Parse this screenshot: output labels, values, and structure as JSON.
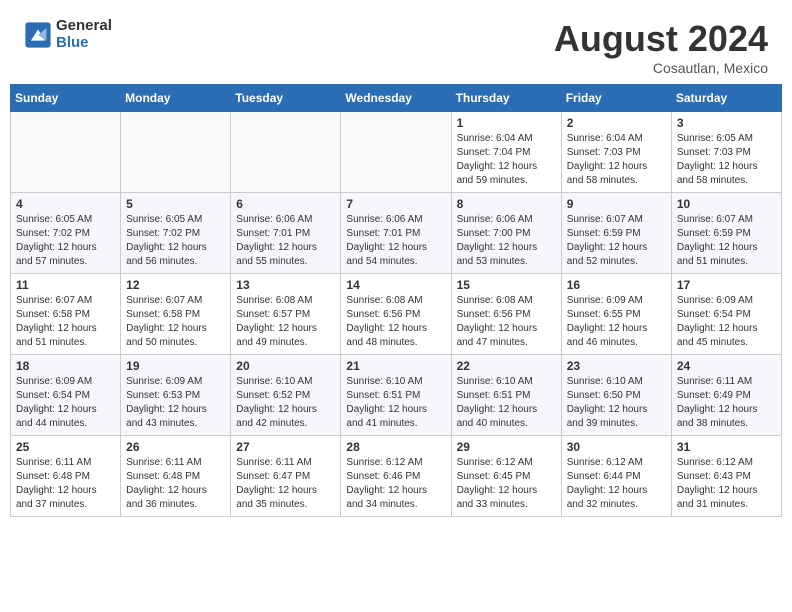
{
  "header": {
    "logo_general": "General",
    "logo_blue": "Blue",
    "title": "August 2024",
    "location": "Cosautlan, Mexico"
  },
  "days_of_week": [
    "Sunday",
    "Monday",
    "Tuesday",
    "Wednesday",
    "Thursday",
    "Friday",
    "Saturday"
  ],
  "weeks": [
    [
      {
        "day": "",
        "info": ""
      },
      {
        "day": "",
        "info": ""
      },
      {
        "day": "",
        "info": ""
      },
      {
        "day": "",
        "info": ""
      },
      {
        "day": "1",
        "info": "Sunrise: 6:04 AM\nSunset: 7:04 PM\nDaylight: 12 hours\nand 59 minutes."
      },
      {
        "day": "2",
        "info": "Sunrise: 6:04 AM\nSunset: 7:03 PM\nDaylight: 12 hours\nand 58 minutes."
      },
      {
        "day": "3",
        "info": "Sunrise: 6:05 AM\nSunset: 7:03 PM\nDaylight: 12 hours\nand 58 minutes."
      }
    ],
    [
      {
        "day": "4",
        "info": "Sunrise: 6:05 AM\nSunset: 7:02 PM\nDaylight: 12 hours\nand 57 minutes."
      },
      {
        "day": "5",
        "info": "Sunrise: 6:05 AM\nSunset: 7:02 PM\nDaylight: 12 hours\nand 56 minutes."
      },
      {
        "day": "6",
        "info": "Sunrise: 6:06 AM\nSunset: 7:01 PM\nDaylight: 12 hours\nand 55 minutes."
      },
      {
        "day": "7",
        "info": "Sunrise: 6:06 AM\nSunset: 7:01 PM\nDaylight: 12 hours\nand 54 minutes."
      },
      {
        "day": "8",
        "info": "Sunrise: 6:06 AM\nSunset: 7:00 PM\nDaylight: 12 hours\nand 53 minutes."
      },
      {
        "day": "9",
        "info": "Sunrise: 6:07 AM\nSunset: 6:59 PM\nDaylight: 12 hours\nand 52 minutes."
      },
      {
        "day": "10",
        "info": "Sunrise: 6:07 AM\nSunset: 6:59 PM\nDaylight: 12 hours\nand 51 minutes."
      }
    ],
    [
      {
        "day": "11",
        "info": "Sunrise: 6:07 AM\nSunset: 6:58 PM\nDaylight: 12 hours\nand 51 minutes."
      },
      {
        "day": "12",
        "info": "Sunrise: 6:07 AM\nSunset: 6:58 PM\nDaylight: 12 hours\nand 50 minutes."
      },
      {
        "day": "13",
        "info": "Sunrise: 6:08 AM\nSunset: 6:57 PM\nDaylight: 12 hours\nand 49 minutes."
      },
      {
        "day": "14",
        "info": "Sunrise: 6:08 AM\nSunset: 6:56 PM\nDaylight: 12 hours\nand 48 minutes."
      },
      {
        "day": "15",
        "info": "Sunrise: 6:08 AM\nSunset: 6:56 PM\nDaylight: 12 hours\nand 47 minutes."
      },
      {
        "day": "16",
        "info": "Sunrise: 6:09 AM\nSunset: 6:55 PM\nDaylight: 12 hours\nand 46 minutes."
      },
      {
        "day": "17",
        "info": "Sunrise: 6:09 AM\nSunset: 6:54 PM\nDaylight: 12 hours\nand 45 minutes."
      }
    ],
    [
      {
        "day": "18",
        "info": "Sunrise: 6:09 AM\nSunset: 6:54 PM\nDaylight: 12 hours\nand 44 minutes."
      },
      {
        "day": "19",
        "info": "Sunrise: 6:09 AM\nSunset: 6:53 PM\nDaylight: 12 hours\nand 43 minutes."
      },
      {
        "day": "20",
        "info": "Sunrise: 6:10 AM\nSunset: 6:52 PM\nDaylight: 12 hours\nand 42 minutes."
      },
      {
        "day": "21",
        "info": "Sunrise: 6:10 AM\nSunset: 6:51 PM\nDaylight: 12 hours\nand 41 minutes."
      },
      {
        "day": "22",
        "info": "Sunrise: 6:10 AM\nSunset: 6:51 PM\nDaylight: 12 hours\nand 40 minutes."
      },
      {
        "day": "23",
        "info": "Sunrise: 6:10 AM\nSunset: 6:50 PM\nDaylight: 12 hours\nand 39 minutes."
      },
      {
        "day": "24",
        "info": "Sunrise: 6:11 AM\nSunset: 6:49 PM\nDaylight: 12 hours\nand 38 minutes."
      }
    ],
    [
      {
        "day": "25",
        "info": "Sunrise: 6:11 AM\nSunset: 6:48 PM\nDaylight: 12 hours\nand 37 minutes."
      },
      {
        "day": "26",
        "info": "Sunrise: 6:11 AM\nSunset: 6:48 PM\nDaylight: 12 hours\nand 36 minutes."
      },
      {
        "day": "27",
        "info": "Sunrise: 6:11 AM\nSunset: 6:47 PM\nDaylight: 12 hours\nand 35 minutes."
      },
      {
        "day": "28",
        "info": "Sunrise: 6:12 AM\nSunset: 6:46 PM\nDaylight: 12 hours\nand 34 minutes."
      },
      {
        "day": "29",
        "info": "Sunrise: 6:12 AM\nSunset: 6:45 PM\nDaylight: 12 hours\nand 33 minutes."
      },
      {
        "day": "30",
        "info": "Sunrise: 6:12 AM\nSunset: 6:44 PM\nDaylight: 12 hours\nand 32 minutes."
      },
      {
        "day": "31",
        "info": "Sunrise: 6:12 AM\nSunset: 6:43 PM\nDaylight: 12 hours\nand 31 minutes."
      }
    ]
  ]
}
